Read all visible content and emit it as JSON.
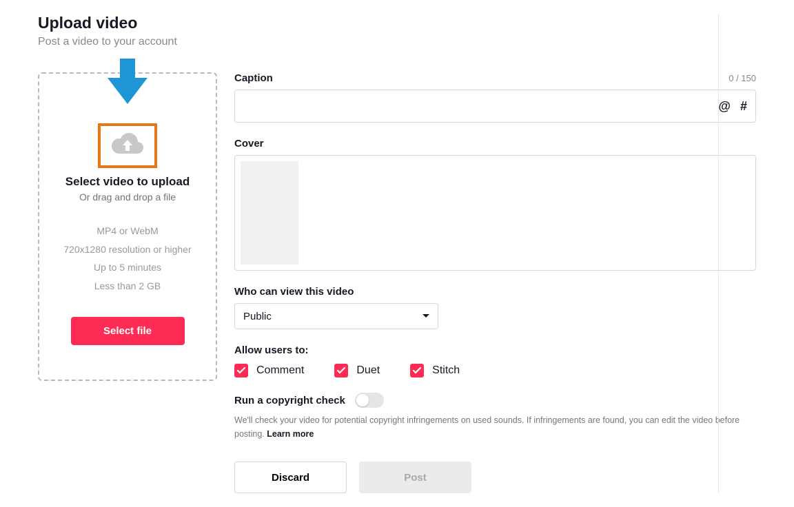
{
  "header": {
    "title": "Upload video",
    "subtitle": "Post a video to your account"
  },
  "upload": {
    "title": "Select video to upload",
    "subtitle": "Or drag and drop a file",
    "specs": [
      "MP4 or WebM",
      "720x1280 resolution or higher",
      "Up to 5 minutes",
      "Less than 2 GB"
    ],
    "button": "Select file"
  },
  "caption": {
    "label": "Caption",
    "counter": "0 / 150",
    "value": "",
    "mention": "@",
    "hashtag": "#"
  },
  "cover": {
    "label": "Cover"
  },
  "privacy": {
    "label": "Who can view this video",
    "value": "Public"
  },
  "allow": {
    "label": "Allow users to:",
    "options": [
      {
        "label": "Comment",
        "checked": true
      },
      {
        "label": "Duet",
        "checked": true
      },
      {
        "label": "Stitch",
        "checked": true
      }
    ]
  },
  "copyright": {
    "label": "Run a copyright check",
    "enabled": false,
    "help": "We'll check your video for potential copyright infringements on used sounds. If infringements are found, you can edit the video before posting. ",
    "learn": "Learn more"
  },
  "actions": {
    "discard": "Discard",
    "post": "Post"
  }
}
